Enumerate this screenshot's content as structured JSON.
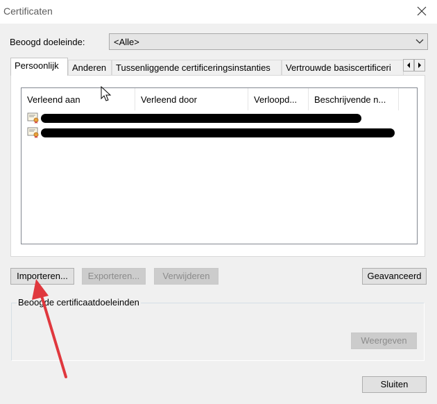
{
  "window": {
    "title": "Certificaten"
  },
  "purpose": {
    "label": "Beoogd doeleinde:",
    "value": "<Alle>"
  },
  "tabs": [
    {
      "label": "Persoonlijk"
    },
    {
      "label": "Anderen"
    },
    {
      "label": "Tussenliggende certificeringsinstanties"
    },
    {
      "label": "Vertrouwde basiscertificeri"
    }
  ],
  "list": {
    "columns": [
      {
        "label": "Verleend aan"
      },
      {
        "label": "Verleend door"
      },
      {
        "label": "Verloopd..."
      },
      {
        "label": "Beschrijvende n..."
      }
    ]
  },
  "buttons": {
    "import": "Importeren...",
    "export": "Exporteren...",
    "remove": "Verwijderen",
    "advanced": "Geavanceerd",
    "view": "Weergeven",
    "close": "Sluiten"
  },
  "group": {
    "label": "Beoogde certificaatdoeleinden"
  },
  "colors": {
    "annotation_arrow": "#e0383e",
    "redaction": "#000000"
  }
}
